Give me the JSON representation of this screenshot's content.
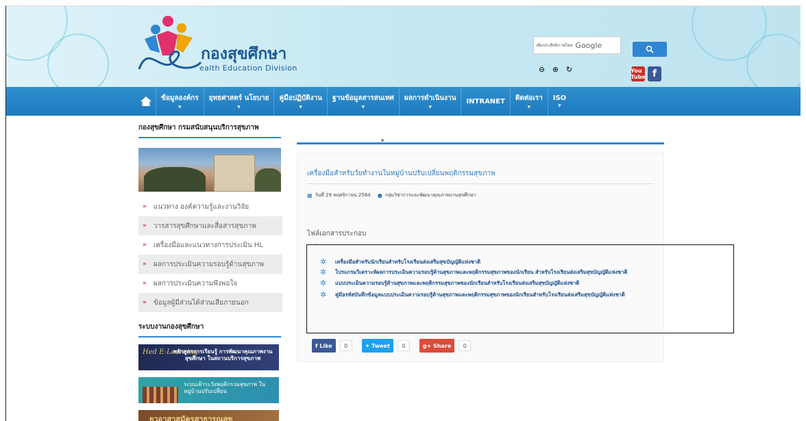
{
  "header": {
    "logo_title": "กองสุขศึกษา",
    "logo_subtitle": "ealth Education Division",
    "search_hint": "เพิ่มประสิทธิภาพโดย",
    "search_label": "Google",
    "search_button_icon": "search-icon",
    "youtube_label": "You Tube",
    "facebook_label": "f"
  },
  "nav": {
    "items": [
      {
        "label": "ข้อมูลองค์กร"
      },
      {
        "label": "ยุทธศาสตร์ นโยบาย"
      },
      {
        "label": "คู่มือปฏิบัติงาน"
      },
      {
        "label": "ฐานข้อมูลสารสนเทศ"
      },
      {
        "label": "ผลการดำเนินงาน"
      },
      {
        "label": "INTRANET"
      },
      {
        "label": "ติดต่อเรา"
      },
      {
        "label": "ISO"
      }
    ]
  },
  "sidebar": {
    "title": "กองสุขศึกษา กรมสนับสนุนบริการสุขภาพ",
    "items": [
      {
        "label": "แนวทาง องค์ความรู้และงานวิจัย"
      },
      {
        "label": "วารสารสุขศึกษาและสื่อสารสุขภาพ"
      },
      {
        "label": "เครื่องมือและแนวทางการประเมิน HL"
      },
      {
        "label": "ผลการประเมินความรอบรู้ด้านสุขภาพ"
      },
      {
        "label": "ผลการประเมินความพึงพอใจ"
      },
      {
        "label": "ข้อมูลผู้มีส่วนได้ส่วนเสียภายนอก"
      }
    ],
    "title2": "ระบบงานกองสุขศึกษา",
    "banner1_script": "Hed E-Learning",
    "banner1_text": "หลักสูตรการเรียนรู้ การพัฒนาคุณภาพงานสุขศึกษา ในสถานบริการสุขภาพ",
    "banner2_text": "ระบบเฝ้าระวังพฤติกรรมสุขภาพ ในหมู่บ้านปรับเปลี่ยน",
    "banner3_text": "ยุวอาสาสมัครสาธารณสุข"
  },
  "article": {
    "title": "เครื่องมือสำหรับวัยทำงานในหมู่บ้านปรับเปลี่ยนพฤติกรรมสุขภาพ",
    "date": "วันที่ 29 พฤศจิกายน 2564",
    "author": "กลุ่มวิชาการและพัฒนาคุณภาพงานสุขศึกษา",
    "attachments_label": "ไฟล์เอกสารประกอบ",
    "attachments": [
      {
        "label": "เครื่องมือสำหรับนักเรียนสำหรับโรงเรียนส่งเสริมสุขบัญญัติแห่งชาติ"
      },
      {
        "label": "โปรแกรมวิเคราะห์ผลการประเมินความรอบรู้ด้านสุขภาพและพฤติกรรมสุขภาพของนักเรียน สำหรับโรงเรียนส่งเสริมสุขบัญญัติแห่งชาติ"
      },
      {
        "label": "แบบประเมินความรอบรู้ด้านสุขภาพและพฤติกรรมสุขภาพของนักเรียนสำหรับโรงเรียนส่งเสริมสุขบัญญัติแห่งชาติ"
      },
      {
        "label": "คู่มือรหัสบันทึกข้อมูลแบบประเมินความรอบรู้ด้านสุขภาพและพฤติกรรมสุขภาพของนักเรียนสำหรับโรงเรียนส่งเสริมสุขบัญญัติแห่งชาติ"
      }
    ]
  },
  "share": {
    "like": "Like",
    "tweet": "Tweet",
    "share": "Share",
    "like_count": "0",
    "tweet_count": "0",
    "share_count": "0"
  },
  "colors": {
    "accent": "#2f86d3",
    "nav": "#1f7abf",
    "link": "#2f7bc0"
  }
}
